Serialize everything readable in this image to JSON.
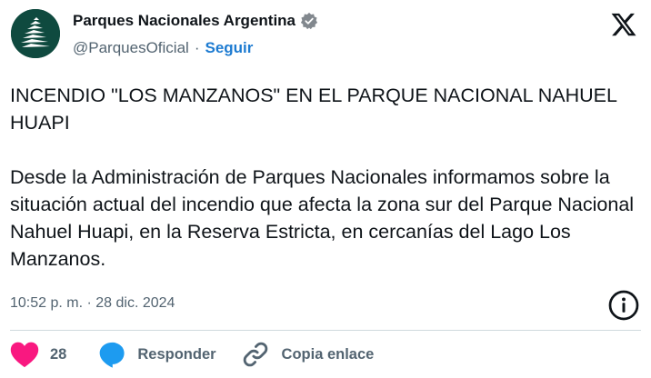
{
  "account": {
    "display_name": "Parques Nacionales Argentina",
    "handle": "@ParquesOficial",
    "separator": "·",
    "follow_label": "Seguir"
  },
  "tweet": {
    "text": "INCENDIO \"LOS MANZANOS\" EN EL PARQUE NACIONAL NAHUEL HUAPI\n\nDesde la Administración de Parques Nacionales informamos sobre la situación actual del incendio que afecta la zona sur del Parque Nacional Nahuel Huapi, en la Reserva Estricta, en cercanías del Lago Los Manzanos.",
    "timestamp": "10:52 p. m. · 28 dic. 2024"
  },
  "actions": {
    "like_count": "28",
    "reply_label": "Responder",
    "copy_link_label": "Copia enlace"
  },
  "icons": {
    "verified": "verified-badge-icon",
    "x_logo": "x-logo-icon",
    "info": "info-icon",
    "like": "heart-icon",
    "reply": "speech-bubble-icon",
    "link": "link-icon"
  },
  "colors": {
    "accent": "#1d7bd1",
    "like": "#f91880",
    "reply_icon": "#1d9bf0",
    "secondary_text": "#536471",
    "avatar_bg": "#0f4a3f"
  }
}
